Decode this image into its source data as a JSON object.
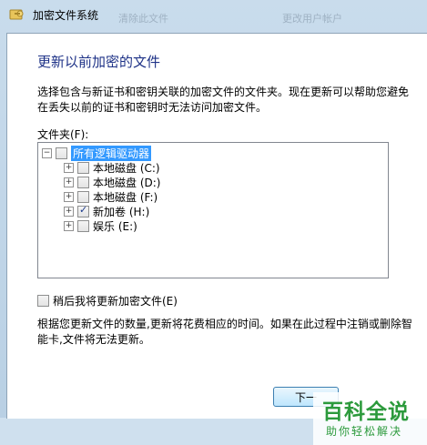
{
  "window": {
    "title": "加密文件系统",
    "background_text_left": "清除此文件",
    "background_text_right": "更改用户帐户"
  },
  "page": {
    "heading": "更新以前加密的文件",
    "description": "选择包含与新证书和密钥关联的加密文件的文件夹。现在更新可以帮助您避免在丢失以前的证书和密钥时无法访问加密文件。",
    "folders_label": "文件夹(F):",
    "tree": {
      "root": {
        "label": "所有逻辑驱动器",
        "checked": false,
        "expanded": true
      },
      "items": [
        {
          "label": "本地磁盘 (C:)",
          "checked": false
        },
        {
          "label": "本地磁盘 (D:)",
          "checked": false
        },
        {
          "label": "本地磁盘 (F:)",
          "checked": false
        },
        {
          "label": "新加卷 (H:)",
          "checked": true
        },
        {
          "label": "娱乐 (E:)",
          "checked": false
        }
      ]
    },
    "later_checkbox_label": "稍后我将更新加密文件(E)",
    "later_checked": false,
    "footer_text": "根据您更新文件的数量,更新将花费相应的时间。如果在此过程中注销或删除智能卡,文件将无法更新。",
    "next_button": "下一"
  },
  "watermark": {
    "title": "百科全说",
    "subtitle": "助你轻松解决"
  },
  "colors": {
    "heading": "#1e3287",
    "selection": "#3399ff",
    "watermark": "#2c9a3c"
  }
}
